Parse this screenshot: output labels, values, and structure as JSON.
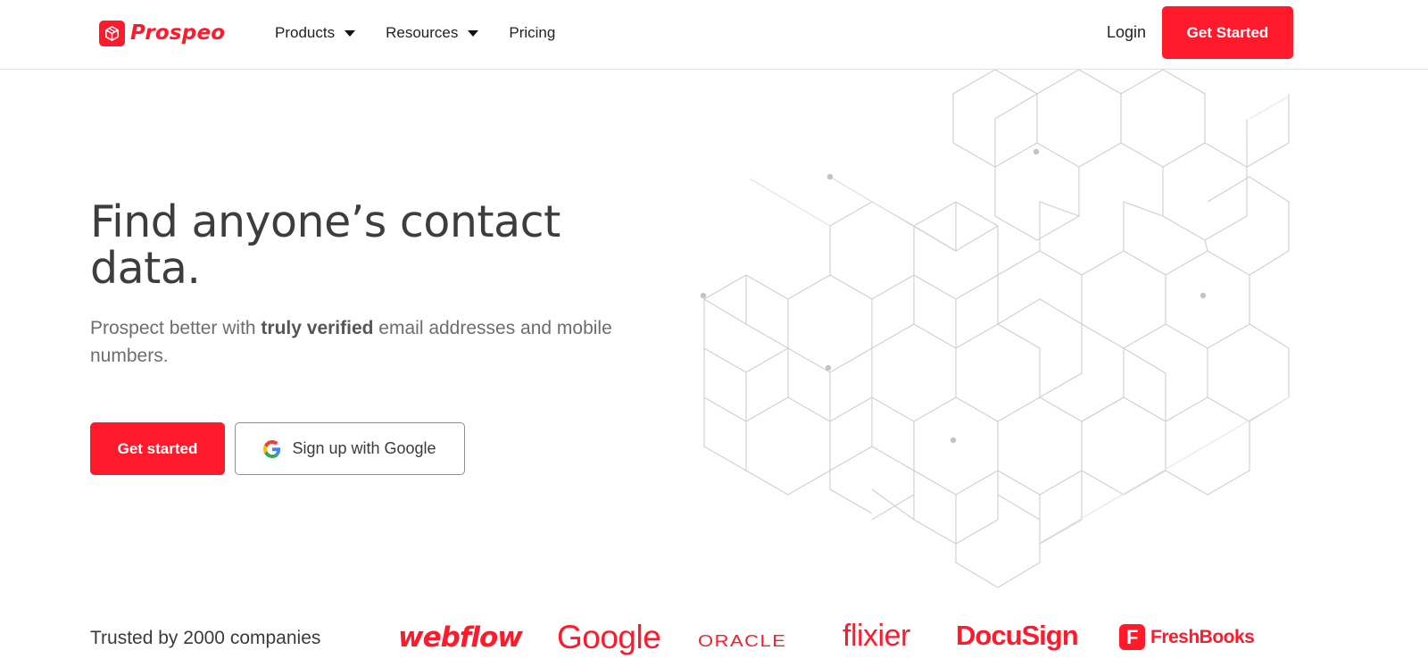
{
  "brand": {
    "name": "Prospeo",
    "accent": "#ff1a2b"
  },
  "nav": {
    "items": [
      {
        "label": "Products",
        "dropdown": true
      },
      {
        "label": "Resources",
        "dropdown": true
      },
      {
        "label": "Pricing",
        "dropdown": false
      }
    ],
    "login_label": "Login",
    "cta_label": "Get Started"
  },
  "hero": {
    "title": "Find anyone’s contact data.",
    "subtitle_prefix": "Prospect better with ",
    "subtitle_bold": "truly verified",
    "subtitle_suffix": " email addresses and mobile numbers.",
    "primary_cta": "Get started",
    "google_cta": "Sign up with Google"
  },
  "trusted": {
    "label": "Trusted by 2000 companies",
    "logos": [
      "webflow",
      "Google",
      "ORACLE",
      "flixier",
      "DocuSign",
      "FreshBooks"
    ]
  },
  "icons": {
    "logo": "cube-icon",
    "dropdown": "caret-down-icon",
    "google": "google-g-icon",
    "freshbooks": "freshbooks-f-icon"
  }
}
